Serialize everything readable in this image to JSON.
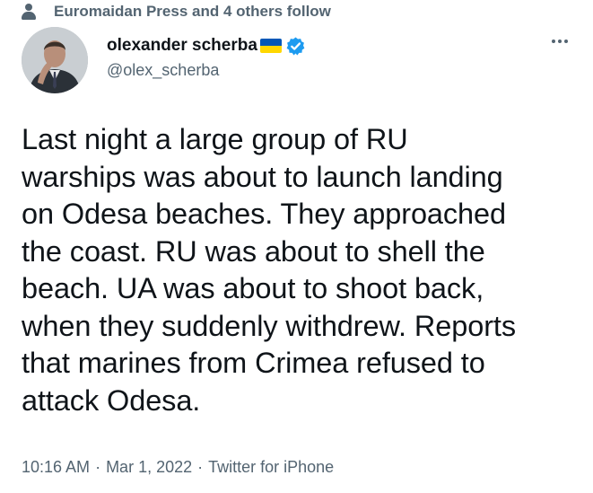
{
  "social_context": {
    "icon": "person-icon",
    "text": "Euromaidan Press and 4 others follow"
  },
  "author": {
    "display_name": "olexander scherba",
    "handle": "@olex_scherba",
    "flag_icon": "ukraine-flag-icon",
    "verified_icon": "verified-badge-icon",
    "verified_color": "#1d9bf0"
  },
  "tweet": {
    "text": "Last night a large group of RU\nwarships was about to launch landing\non Odesa beaches. They approached\nthe coast. RU was about to shell the\nbeach. UA was about to shoot back,\nwhen they suddenly withdrew. Reports\nthat marines from Crimea refused to\nattack Odesa."
  },
  "meta": {
    "time": "10:16 AM",
    "date": "Mar 1, 2022",
    "source": "Twitter for iPhone",
    "separator": "·"
  },
  "colors": {
    "text": "#0f1419",
    "secondary": "#536471",
    "flag_blue": "#0057b7",
    "flag_yellow": "#ffd700"
  }
}
